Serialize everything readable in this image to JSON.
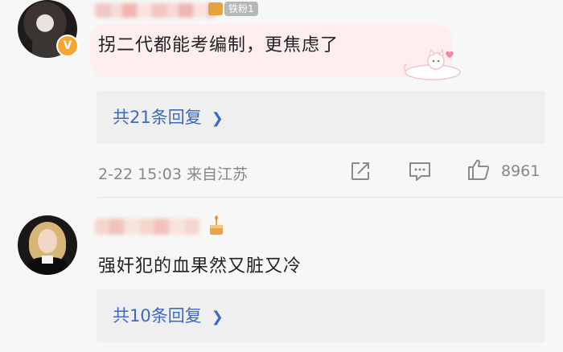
{
  "comments": [
    {
      "fan_badge": "铁粉1",
      "text": "拐二代都能考编制，更焦虑了",
      "reply_link": "共21条回复",
      "meta": "2-22 15:03 来自江苏",
      "like_count": "8961",
      "verified_badge": "V",
      "icons": [
        "verified-badge-icon",
        "rank-icon",
        "cat-sticker-icon",
        "chevron-right-icon",
        "share-icon",
        "comment-icon",
        "like-icon"
      ]
    },
    {
      "text": "强奸犯的血果然又脏又冷",
      "reply_link": "共10条回复",
      "icons": [
        "cake-icon",
        "chevron-right-icon"
      ]
    }
  ],
  "colors": {
    "link": "#3b69c4",
    "bubble": "#ffeef0",
    "reply_box": "#efefef",
    "meta_text": "#888888",
    "verified": "#f6a531"
  }
}
